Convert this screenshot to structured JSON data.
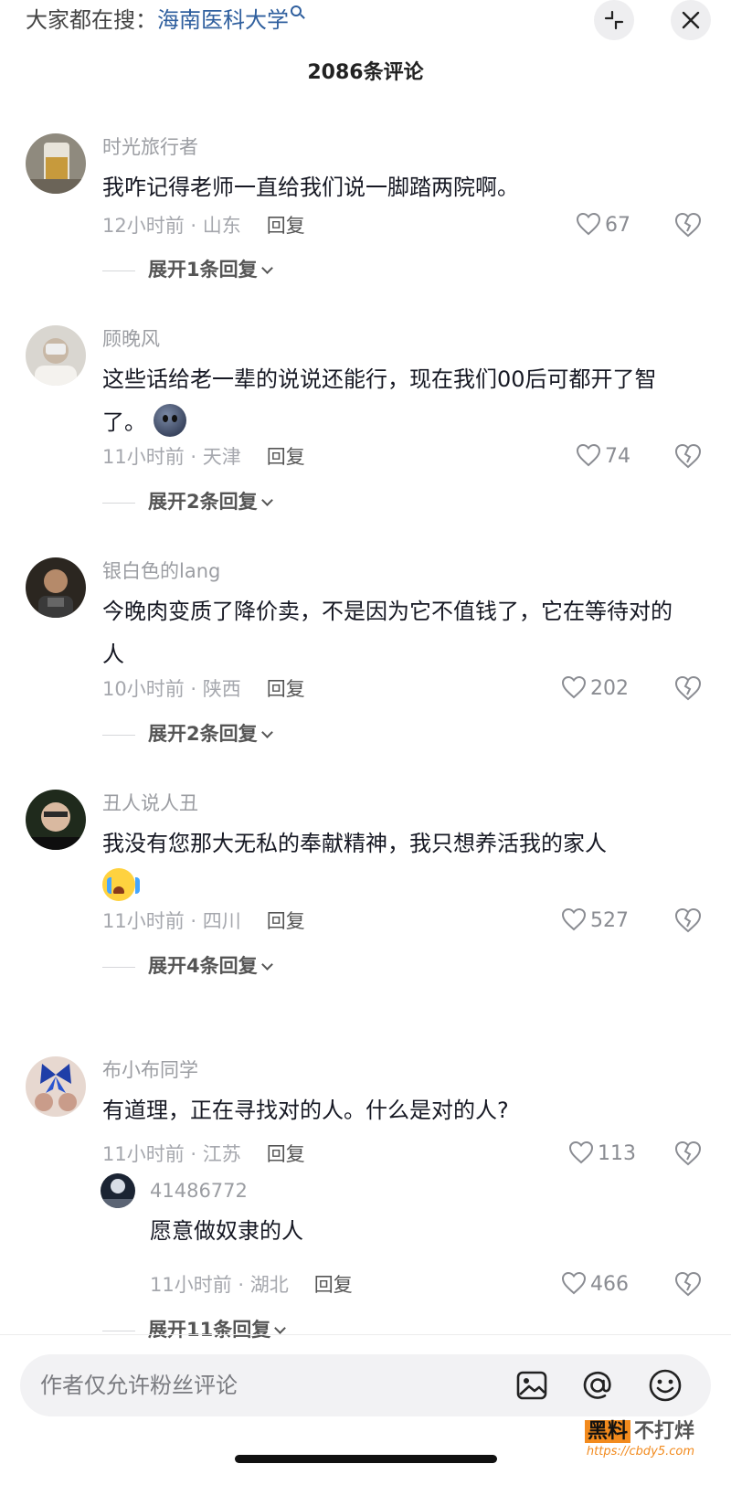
{
  "header": {
    "search_prefix": "大家都在搜：",
    "search_keyword": "海南医科大学",
    "comment_count": "2086条评论"
  },
  "comments": [
    {
      "username": "时光旅行者",
      "text": "我咋记得老师一直给我们说一脚踏两院啊。",
      "time_location": "12小时前 · 山东",
      "reply_label": "回复",
      "likes": "67",
      "expand_label": "展开1条回复"
    },
    {
      "username": "顾晚风",
      "text": "这些话给老一辈的说说还能行，现在我们00后可都开了智了。",
      "emoji": "blob-emoji",
      "time_location": "11小时前 · 天津",
      "reply_label": "回复",
      "likes": "74",
      "expand_label": "展开2条回复"
    },
    {
      "username": "银白色的lang",
      "text": "今晚肉变质了降价卖，不是因为它不值钱了，它在等待对的人",
      "time_location": "10小时前 · 陕西",
      "reply_label": "回复",
      "likes": "202",
      "expand_label": "展开2条回复"
    },
    {
      "username": "丑人说人丑",
      "text": "我没有您那大无私的奉献精神，我只想养活我的家人",
      "emoji": "loudly-crying-emoji",
      "time_location": "11小时前 · 四川",
      "reply_label": "回复",
      "likes": "527",
      "expand_label": "展开4条回复"
    },
    {
      "username": "布小布同学",
      "text": "有道理，正在寻找对的人。什么是对的人?",
      "time_location": "11小时前 · 江苏",
      "reply_label": "回复",
      "likes": "113",
      "reply": {
        "username": "41486772",
        "text": "愿意做奴隶的人",
        "time_location": "11小时前 · 湖北",
        "reply_label": "回复",
        "likes": "466"
      },
      "expand_label": "展开11条回复"
    }
  ],
  "input": {
    "placeholder": "作者仅允许粉丝评论"
  },
  "icons": {
    "collapse": "collapse-icon",
    "close": "close-icon",
    "like": "heart-icon",
    "dislike": "broken-heart-icon",
    "image": "image-icon",
    "mention": "at-icon",
    "emoji": "smiley-icon"
  },
  "watermark": {
    "main_a": "黑料",
    "main_b": "不打烊",
    "url": "https://cbdy5.com"
  },
  "colors": {
    "keyword": "#2f5f9e",
    "watermark": "#f28a1d"
  }
}
